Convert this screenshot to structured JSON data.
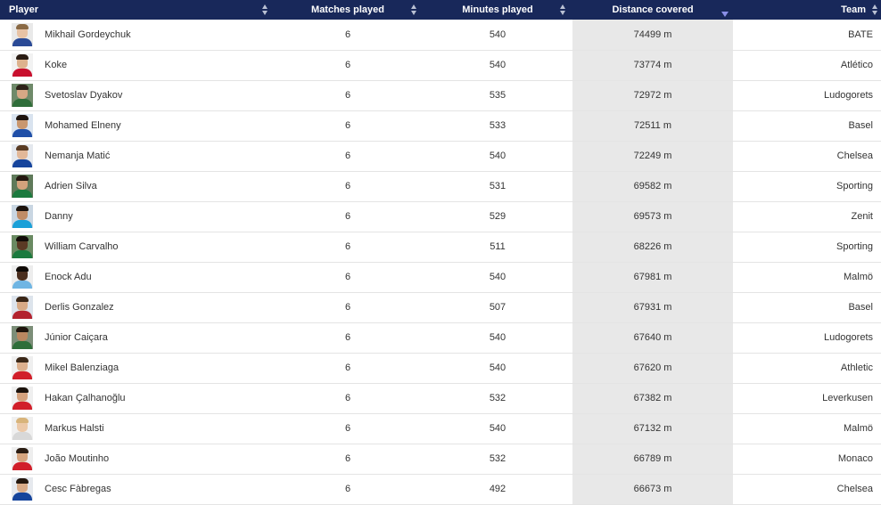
{
  "table": {
    "headers": {
      "player": "Player",
      "matches": "Matches played",
      "minutes": "Minutes played",
      "distance": "Distance covered",
      "team": "Team"
    },
    "sorted_column": "distance",
    "sort_direction": "descending",
    "rows": [
      {
        "player": "Mikhail Gordeychuk",
        "matches": "6",
        "minutes": "540",
        "distance": "74499 m",
        "team": "BATE",
        "avatar": {
          "bg": "#e9e9e9",
          "skin": "#e8c3a5",
          "hair": "#8a6a45",
          "shirt": "#2a4a96"
        }
      },
      {
        "player": "Koke",
        "matches": "6",
        "minutes": "540",
        "distance": "73774 m",
        "team": "Atlético",
        "avatar": {
          "bg": "#f2f2f2",
          "skin": "#ddb28e",
          "hair": "#2b1d14",
          "shirt": "#c8102e"
        }
      },
      {
        "player": "Svetoslav Dyakov",
        "matches": "6",
        "minutes": "535",
        "distance": "72972 m",
        "team": "Ludogorets",
        "avatar": {
          "bg": "#6f8a6a",
          "skin": "#d7a885",
          "hair": "#2d2318",
          "shirt": "#2f6e3a"
        }
      },
      {
        "player": "Mohamed Elneny",
        "matches": "6",
        "minutes": "533",
        "distance": "72511 m",
        "team": "Basel",
        "avatar": {
          "bg": "#d9e3ef",
          "skin": "#c9976f",
          "hair": "#1e140e",
          "shirt": "#1f4fa8"
        }
      },
      {
        "player": "Nemanja Matić",
        "matches": "6",
        "minutes": "540",
        "distance": "72249 m",
        "team": "Chelsea",
        "avatar": {
          "bg": "#e4e8ee",
          "skin": "#e2b899",
          "hair": "#5a3c24",
          "shirt": "#15449c"
        }
      },
      {
        "player": "Adrien Silva",
        "matches": "6",
        "minutes": "531",
        "distance": "69582 m",
        "team": "Sporting",
        "avatar": {
          "bg": "#5f7a5a",
          "skin": "#d3a27c",
          "hair": "#241810",
          "shirt": "#1b7a3e"
        }
      },
      {
        "player": "Danny",
        "matches": "6",
        "minutes": "529",
        "distance": "69573 m",
        "team": "Zenit",
        "avatar": {
          "bg": "#c9d6e2",
          "skin": "#c08c66",
          "hair": "#1c130d",
          "shirt": "#1aa0d8"
        }
      },
      {
        "player": "William Carvalho",
        "matches": "6",
        "minutes": "511",
        "distance": "68226 m",
        "team": "Sporting",
        "avatar": {
          "bg": "#6a8a62",
          "skin": "#5a3a24",
          "hair": "#120c08",
          "shirt": "#1b7a3e"
        }
      },
      {
        "player": "Enock Adu",
        "matches": "6",
        "minutes": "540",
        "distance": "67981 m",
        "team": "Malmö",
        "avatar": {
          "bg": "#ededed",
          "skin": "#4a2e1e",
          "hair": "#0f0a06",
          "shirt": "#6fb5e3"
        }
      },
      {
        "player": "Derlis Gonzalez",
        "matches": "6",
        "minutes": "507",
        "distance": "67931 m",
        "team": "Basel",
        "avatar": {
          "bg": "#dde4ec",
          "skin": "#d8aa86",
          "hair": "#3a2616",
          "shirt": "#b3232f"
        }
      },
      {
        "player": "Júnior Caiçara",
        "matches": "6",
        "minutes": "540",
        "distance": "67640 m",
        "team": "Ludogorets",
        "avatar": {
          "bg": "#7c8e78",
          "skin": "#b98760",
          "hair": "#1e140c",
          "shirt": "#2f6e3a"
        }
      },
      {
        "player": "Mikel Balenziaga",
        "matches": "6",
        "minutes": "540",
        "distance": "67620 m",
        "team": "Athletic",
        "avatar": {
          "bg": "#efefef",
          "skin": "#dcb08e",
          "hair": "#3b2818",
          "shirt": "#d11f2a"
        }
      },
      {
        "player": "Hakan Çalhanoğlu",
        "matches": "6",
        "minutes": "532",
        "distance": "67382 m",
        "team": "Leverkusen",
        "avatar": {
          "bg": "#efefef",
          "skin": "#d4a27e",
          "hair": "#1b120c",
          "shirt": "#d11f2a"
        }
      },
      {
        "player": "Markus Halsti",
        "matches": "6",
        "minutes": "540",
        "distance": "67132 m",
        "team": "Malmö",
        "avatar": {
          "bg": "#f0f0f0",
          "skin": "#ecc9a8",
          "hair": "#d8b47a",
          "shirt": "#d8d8d8"
        }
      },
      {
        "player": "João Moutinho",
        "matches": "6",
        "minutes": "532",
        "distance": "66789 m",
        "team": "Monaco",
        "avatar": {
          "bg": "#eeeeee",
          "skin": "#d6a57f",
          "hair": "#2a1c12",
          "shirt": "#d11f2a"
        }
      },
      {
        "player": "Cesc Fàbregas",
        "matches": "6",
        "minutes": "492",
        "distance": "66673 m",
        "team": "Chelsea",
        "avatar": {
          "bg": "#e6e9ee",
          "skin": "#d9ab88",
          "hair": "#24170e",
          "shirt": "#15449c"
        }
      }
    ]
  },
  "colors": {
    "header_bg": "#18285a",
    "header_text": "#ffffff",
    "sorted_column_bg": "#e8e8e8",
    "row_divider": "#e4e4e4",
    "sort_active_arrow": "#8a8fe8"
  }
}
